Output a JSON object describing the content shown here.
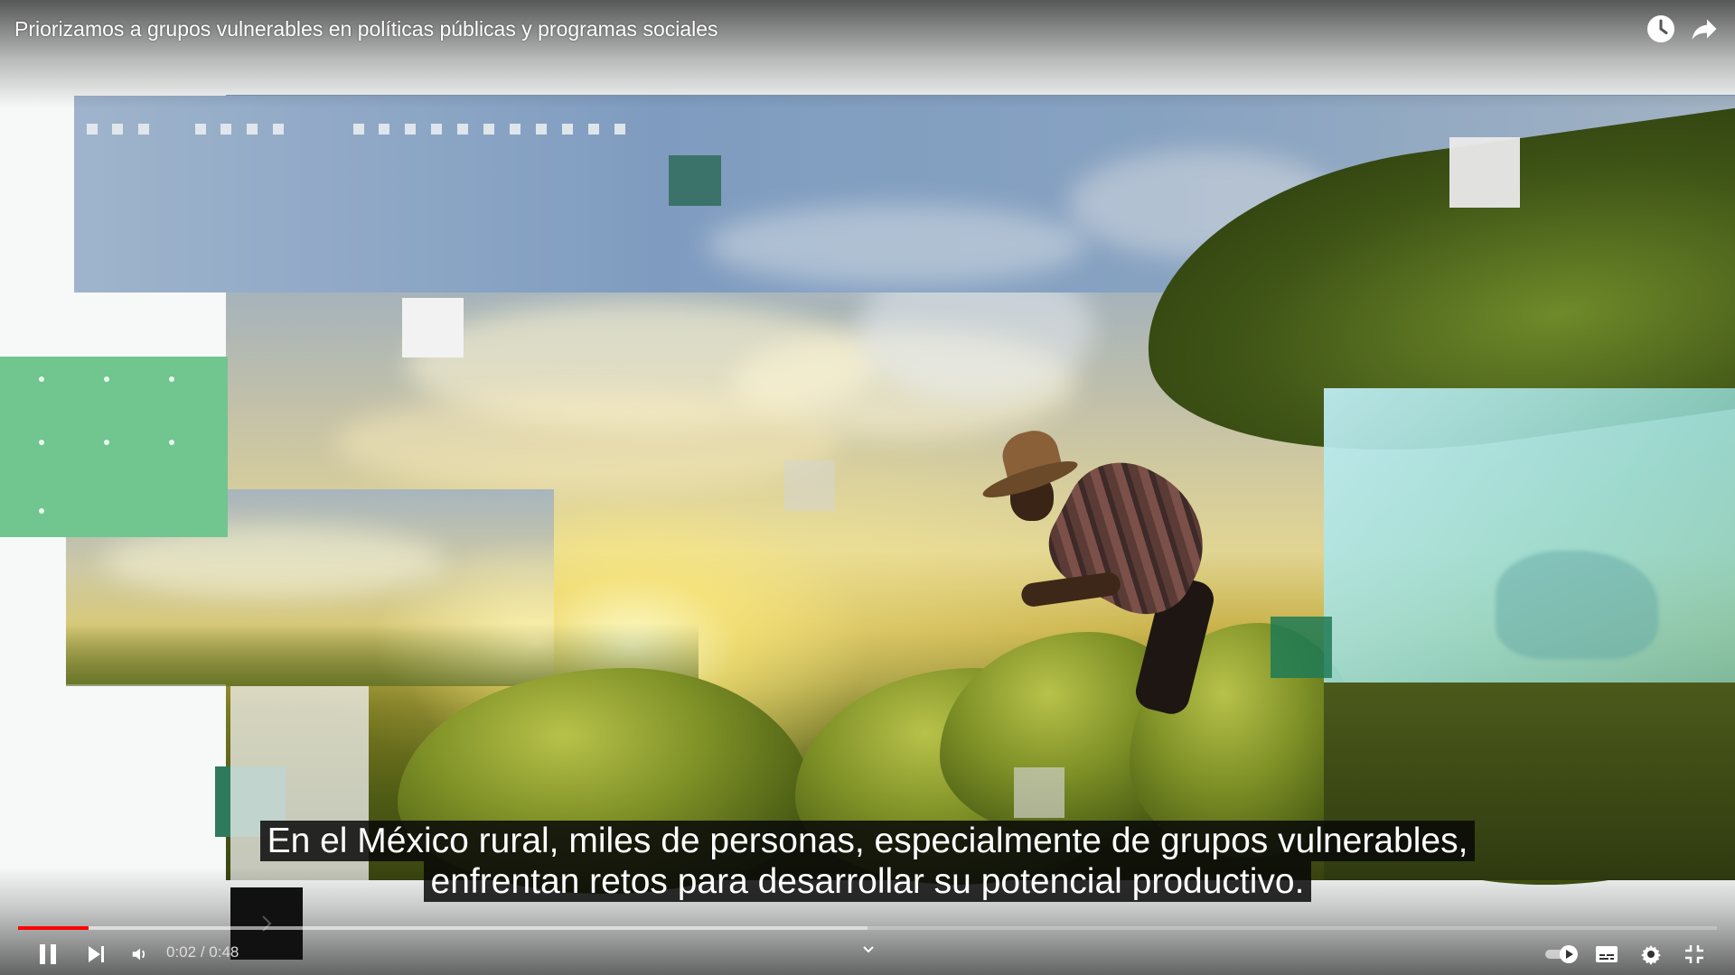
{
  "video": {
    "title": "Priorizamos a grupos vulnerables en políticas públicas y programas sociales"
  },
  "top_controls": {
    "watch_later_icon": "clock-icon",
    "share_icon": "share-arrow-icon"
  },
  "captions": {
    "line1": "En el México rural, miles de personas, especialmente de grupos vulnerables,",
    "line2": "enfrentan retos para desarrollar su potencial productivo."
  },
  "player": {
    "current_time": "0:02",
    "separator": " / ",
    "duration": "0:48",
    "played_fraction": 0.0417,
    "buffered_fraction": 0.5
  },
  "bottom_controls": {
    "play_pause_icon": "pause-icon",
    "next_icon": "next-icon",
    "volume_icon": "volume-icon",
    "chapters_icon": "chevron-down-icon",
    "autoplay_icon": "autoplay-toggle-icon",
    "subtitles_icon": "subtitles-icon",
    "settings_icon": "gear-icon",
    "fullscreen_icon": "exit-fullscreen-icon"
  },
  "colors": {
    "progress_played": "#ff0000",
    "accent_green": "#71c58f",
    "dark_green": "#2e7a5c"
  }
}
